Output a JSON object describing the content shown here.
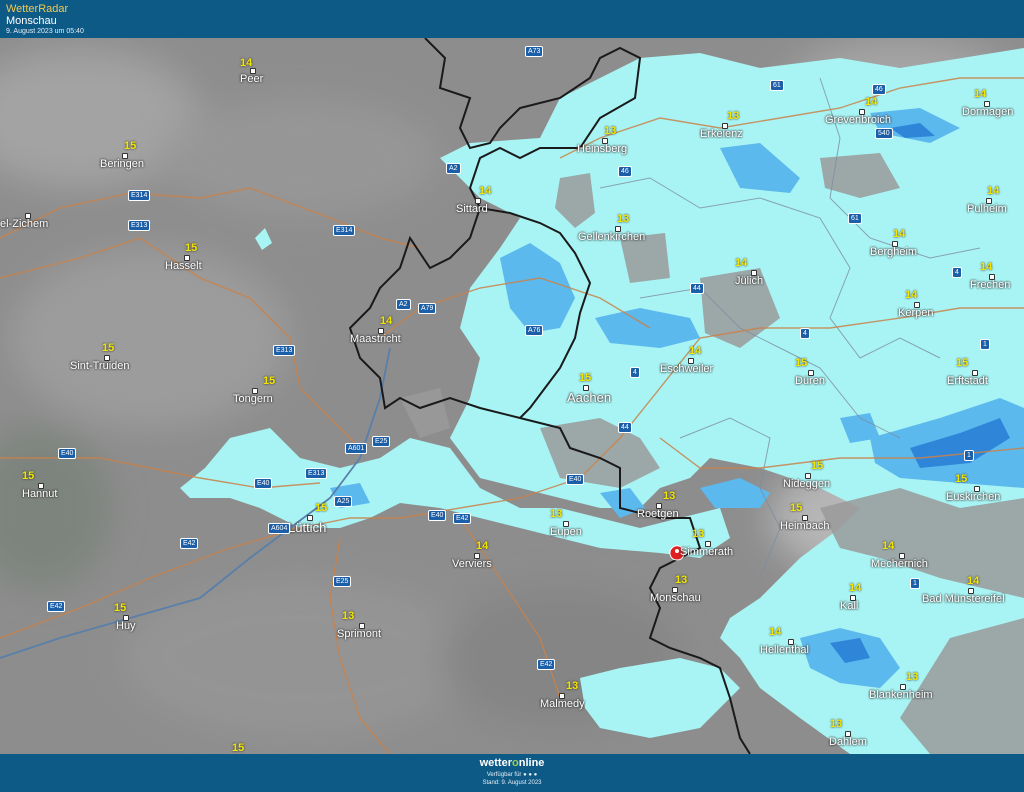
{
  "header": {
    "app_name": "WetterRadar",
    "location": "Monschau",
    "timestamp": "9. August 2023 um 05:40"
  },
  "footer": {
    "brand_pre": "wetter",
    "brand_o": "o",
    "brand_post": "nline",
    "available": "Verfügbar für ● ● ●",
    "stand": "Stand: 9. August 2023"
  },
  "colors": {
    "header_bg": "#0e5a86",
    "rain_light": "#a8f4f4",
    "rain_medium": "#5cb9ee",
    "rain_heavy": "#2f86d9",
    "temperature": "#f2e600",
    "border": "#222222",
    "marker": "#e02020"
  },
  "map": {
    "marker_icon": "location-pin-icon",
    "cities": [
      {
        "name": "Peer",
        "temp": "14"
      },
      {
        "name": "Beringen",
        "temp": "15"
      },
      {
        "name": "el-Zichem",
        "temp": ""
      },
      {
        "name": "Hasselt",
        "temp": "15"
      },
      {
        "name": "Sint-Truiden",
        "temp": "15"
      },
      {
        "name": "Tongern",
        "temp": "15"
      },
      {
        "name": "Maastricht",
        "temp": "14"
      },
      {
        "name": "Sittard",
        "temp": "14"
      },
      {
        "name": "Heinsberg",
        "temp": "13"
      },
      {
        "name": "Erkelenz",
        "temp": "13"
      },
      {
        "name": "Grevenbroich",
        "temp": "14"
      },
      {
        "name": "Dormagen",
        "temp": "14"
      },
      {
        "name": "Gellenkirchen",
        "temp": "13"
      },
      {
        "name": "Pulheim",
        "temp": "14"
      },
      {
        "name": "Bergheim",
        "temp": "14"
      },
      {
        "name": "Jülich",
        "temp": "14"
      },
      {
        "name": "Frechen",
        "temp": "14"
      },
      {
        "name": "Kerpen",
        "temp": "14"
      },
      {
        "name": "Eschweiler",
        "temp": "14"
      },
      {
        "name": "Düren",
        "temp": "15"
      },
      {
        "name": "Erftstadt",
        "temp": "15"
      },
      {
        "name": "Aachen",
        "temp": "15"
      },
      {
        "name": "Hannut",
        "temp": "15"
      },
      {
        "name": "Lüttich",
        "temp": "15"
      },
      {
        "name": "Eupen",
        "temp": "13"
      },
      {
        "name": "Roetgen",
        "temp": "13"
      },
      {
        "name": "Nideggen",
        "temp": "15"
      },
      {
        "name": "Heimbach",
        "temp": "15"
      },
      {
        "name": "Euskirchen",
        "temp": "15"
      },
      {
        "name": "Simmerath",
        "temp": "13"
      },
      {
        "name": "Verviers",
        "temp": "14"
      },
      {
        "name": "Mechernich",
        "temp": "14"
      },
      {
        "name": "Monschau",
        "temp": "13"
      },
      {
        "name": "Kall",
        "temp": "14"
      },
      {
        "name": "Bad Münstereifel",
        "temp": "14"
      },
      {
        "name": "Huy",
        "temp": "15"
      },
      {
        "name": "Sprimont",
        "temp": "13"
      },
      {
        "name": "Hellenthal",
        "temp": "14"
      },
      {
        "name": "Malmedy",
        "temp": "13"
      },
      {
        "name": "Blankenheim",
        "temp": "13"
      },
      {
        "name": "Dahlem",
        "temp": "13"
      }
    ],
    "extra_temp": "15",
    "roads": [
      "A73",
      "A2",
      "61",
      "46",
      "540",
      "46",
      "E314",
      "E313",
      "E314",
      "61",
      "A2",
      "A79",
      "A76",
      "4",
      "44",
      "4",
      "E313",
      "4",
      "1",
      "E25",
      "A601",
      "E313",
      "E40",
      "E40",
      "E40",
      "A25",
      "A604",
      "E40",
      "E42",
      "44",
      "E42",
      "E25",
      "1",
      "1",
      "E42",
      "E42"
    ]
  }
}
